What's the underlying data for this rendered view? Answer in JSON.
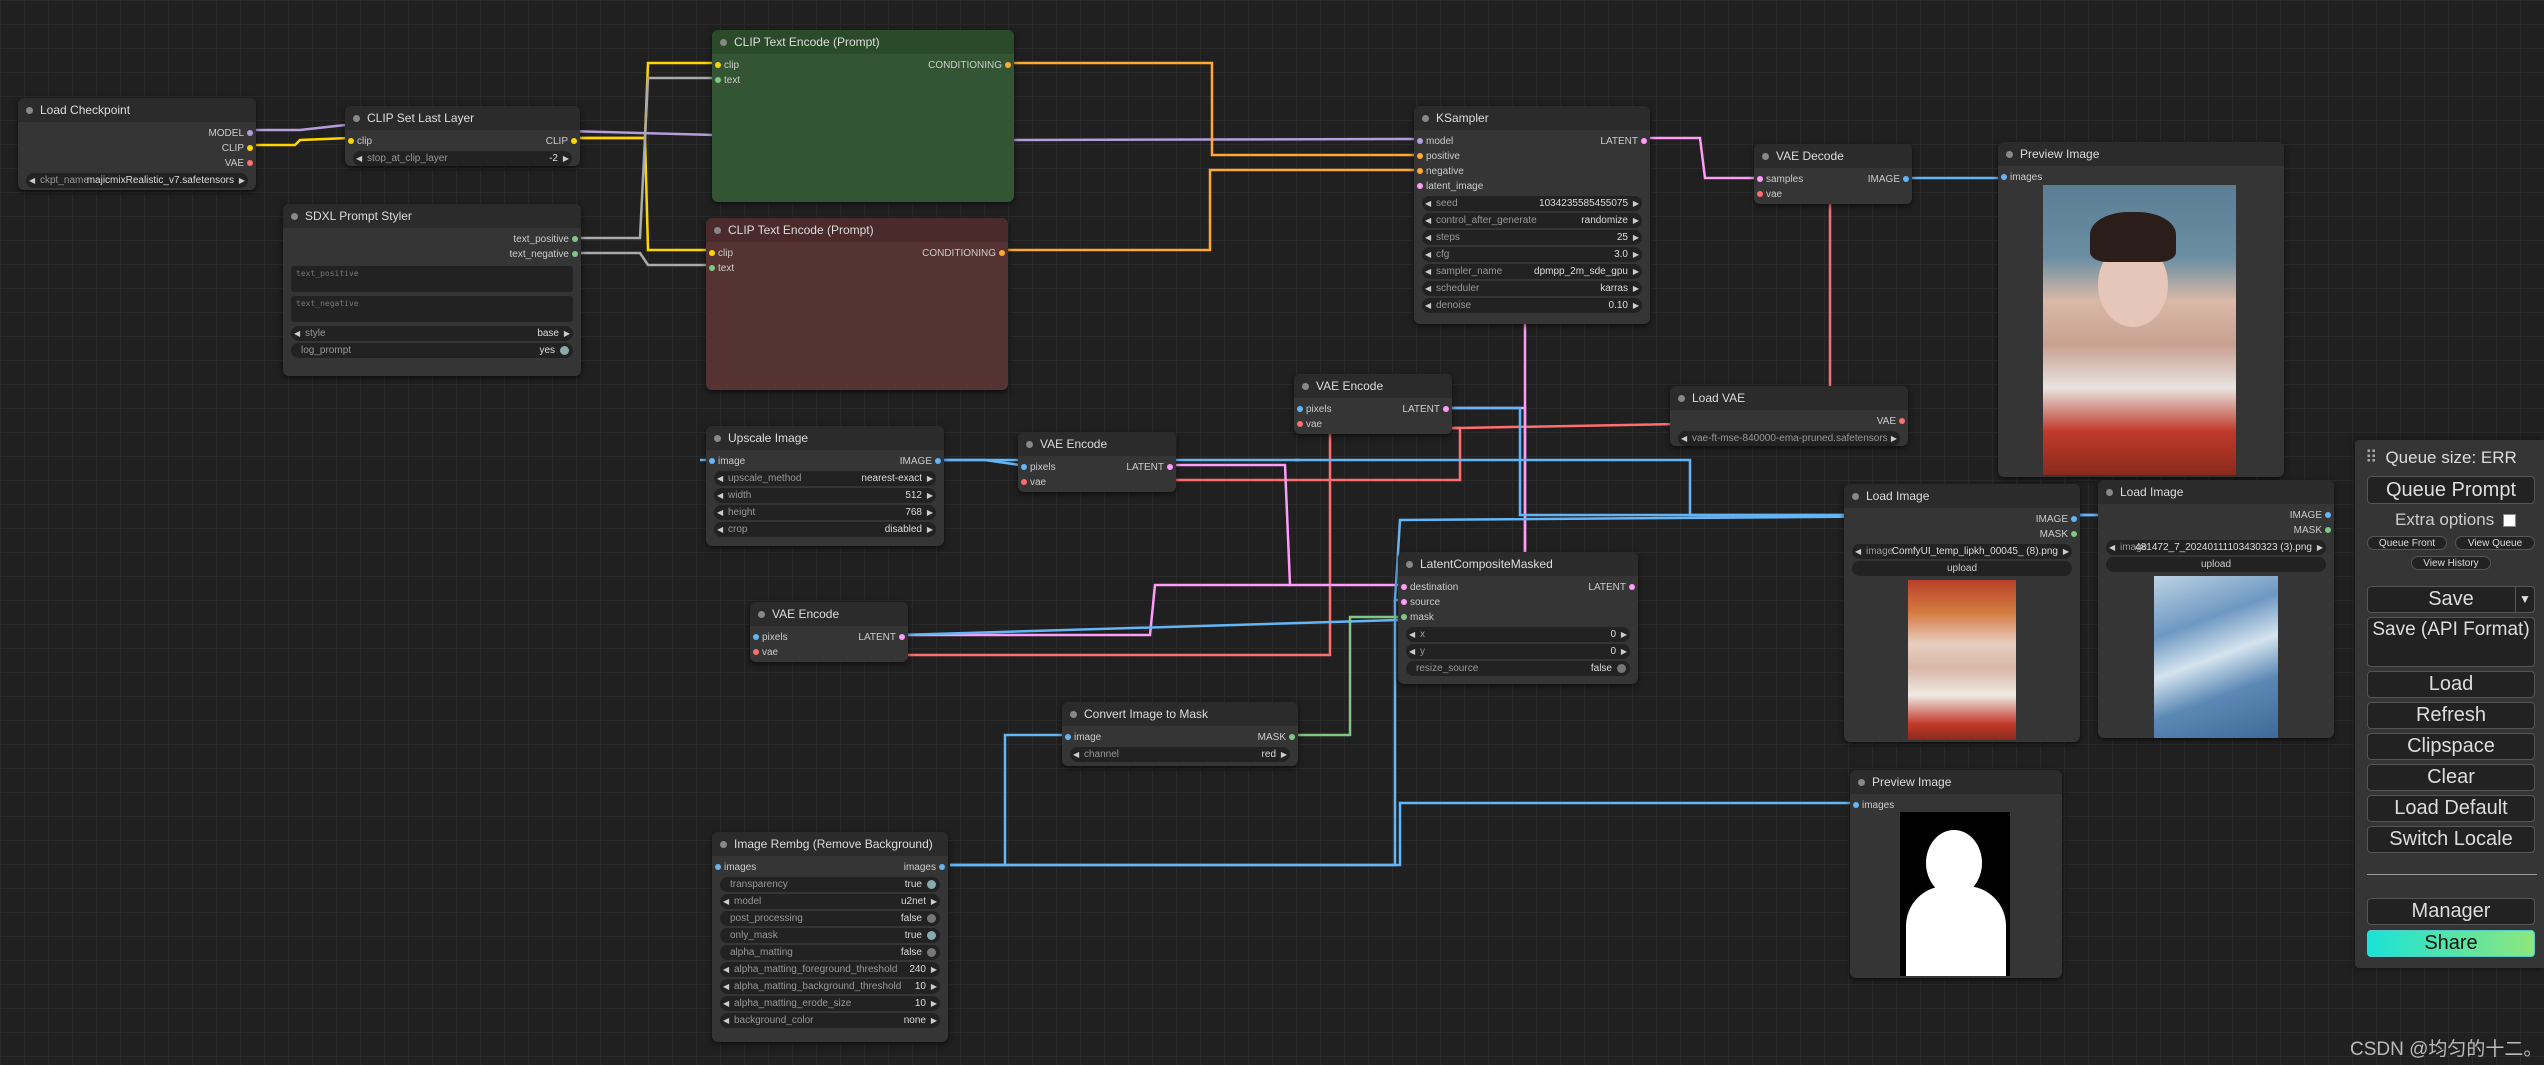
{
  "nodes": {
    "load_checkpoint": {
      "title": "Load Checkpoint",
      "outputs": [
        "MODEL",
        "CLIP",
        "VAE"
      ],
      "ckpt_label": "ckpt_name",
      "ckpt_value": "majicmixRealistic_v7.safetensors"
    },
    "clip_set_last_layer": {
      "title": "CLIP Set Last Layer",
      "input": "clip",
      "output": "CLIP",
      "widget_label": "stop_at_clip_layer",
      "widget_value": "-2"
    },
    "sdxl_styler": {
      "title": "SDXL Prompt Styler",
      "outputs": [
        "text_positive",
        "text_negative"
      ],
      "text_positive_placeholder": "text_positive",
      "text_negative_placeholder": "text_negative",
      "style_label": "style",
      "style_value": "base",
      "log_label": "log_prompt",
      "log_value": "yes"
    },
    "clip_text_pos": {
      "title": "CLIP Text Encode (Prompt)",
      "inputs": [
        "clip",
        "text"
      ],
      "output": "CONDITIONING"
    },
    "clip_text_neg": {
      "title": "CLIP Text Encode (Prompt)",
      "inputs": [
        "clip",
        "text"
      ],
      "output": "CONDITIONING"
    },
    "ksampler": {
      "title": "KSampler",
      "inputs": [
        "model",
        "positive",
        "negative",
        "latent_image"
      ],
      "output": "LATENT",
      "widgets": [
        {
          "label": "seed",
          "value": "1034235585455075"
        },
        {
          "label": "control_after_generate",
          "value": "randomize"
        },
        {
          "label": "steps",
          "value": "25"
        },
        {
          "label": "cfg",
          "value": "3.0"
        },
        {
          "label": "sampler_name",
          "value": "dpmpp_2m_sde_gpu"
        },
        {
          "label": "scheduler",
          "value": "karras"
        },
        {
          "label": "denoise",
          "value": "0.10"
        }
      ]
    },
    "vae_decode": {
      "title": "VAE Decode",
      "inputs": [
        "samples",
        "vae"
      ],
      "output": "IMAGE"
    },
    "preview_top": {
      "title": "Preview Image",
      "input": "images"
    },
    "upscale_image": {
      "title": "Upscale Image",
      "input": "image",
      "output": "IMAGE",
      "widgets": [
        {
          "label": "upscale_method",
          "value": "nearest-exact"
        },
        {
          "label": "width",
          "value": "512"
        },
        {
          "label": "height",
          "value": "768"
        },
        {
          "label": "crop",
          "value": "disabled"
        }
      ]
    },
    "vae_encode_mid": {
      "title": "VAE Encode",
      "inputs": [
        "pixels",
        "vae"
      ],
      "output": "LATENT"
    },
    "vae_encode_top": {
      "title": "VAE Encode",
      "inputs": [
        "pixels",
        "vae"
      ],
      "output": "LATENT"
    },
    "vae_encode_low": {
      "title": "VAE Encode",
      "inputs": [
        "pixels",
        "vae"
      ],
      "output": "LATENT"
    },
    "load_vae": {
      "title": "Load VAE",
      "output": "VAE",
      "widget_value": "vae-ft-mse-840000-ema-pruned.safetensors"
    },
    "load_image_1": {
      "title": "Load Image",
      "outputs": [
        "IMAGE",
        "MASK"
      ],
      "image_label": "image",
      "image_value": "ComfyUI_temp_lipkh_00045_ (8).png",
      "upload": "upload"
    },
    "load_image_2": {
      "title": "Load Image",
      "outputs": [
        "IMAGE",
        "MASK"
      ],
      "image_label": "image",
      "image_value": "481472_7_20240111103430323 (3).png",
      "upload": "upload"
    },
    "latent_composite": {
      "title": "LatentCompositeMasked",
      "inputs": [
        "destination",
        "source",
        "mask"
      ],
      "output": "LATENT",
      "widgets": [
        {
          "label": "x",
          "value": "0"
        },
        {
          "label": "y",
          "value": "0"
        }
      ],
      "toggle_label": "resize_source",
      "toggle_value": "false"
    },
    "convert_mask": {
      "title": "Convert Image to Mask",
      "input": "image",
      "output": "MASK",
      "widget_label": "channel",
      "widget_value": "red"
    },
    "preview_bottom": {
      "title": "Preview Image",
      "input": "images"
    },
    "rembg": {
      "title": "Image Rembg (Remove Background)",
      "input": "images",
      "output": "images",
      "widgets": [
        {
          "label": "transparency",
          "value": "true",
          "type": "toggle",
          "on": true
        },
        {
          "label": "model",
          "value": "u2net",
          "type": "combo"
        },
        {
          "label": "post_processing",
          "value": "false",
          "type": "toggle",
          "on": false
        },
        {
          "label": "only_mask",
          "value": "true",
          "type": "toggle",
          "on": true
        },
        {
          "label": "alpha_matting",
          "value": "false",
          "type": "toggle",
          "on": false
        },
        {
          "label": "alpha_matting_foreground_threshold",
          "value": "240",
          "type": "combo"
        },
        {
          "label": "alpha_matting_background_threshold",
          "value": "10",
          "type": "combo"
        },
        {
          "label": "alpha_matting_erode_size",
          "value": "10",
          "type": "combo"
        },
        {
          "label": "background_color",
          "value": "none",
          "type": "combo"
        }
      ]
    }
  },
  "menu": {
    "queue_size": "Queue size: ERR",
    "queue_prompt": "Queue Prompt",
    "extra_options": "Extra options",
    "queue_front": "Queue Front",
    "view_queue": "View Queue",
    "view_history": "View History",
    "save": "Save",
    "save_api": "Save (API Format)",
    "load": "Load",
    "refresh": "Refresh",
    "clipspace": "Clipspace",
    "clear": "Clear",
    "load_default": "Load Default",
    "switch_locale": "Switch Locale",
    "manager": "Manager",
    "share": "Share"
  },
  "watermark": "CSDN @均匀的十二。",
  "colors": {
    "model": "#b39ddb",
    "clip": "#ffd500",
    "vae": "#ff6e6e",
    "conditioning": "#ffa931",
    "latent": "#ff9cf9",
    "image": "#64b5f6",
    "mask": "#81c784",
    "text": "#aaaaaa",
    "share_start": "#19e3d6",
    "share_end": "#8fe67c"
  }
}
